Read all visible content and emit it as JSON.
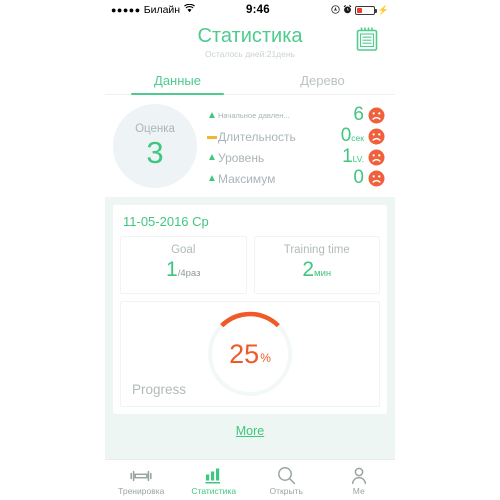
{
  "status_bar": {
    "signal_dots": "●●●●●",
    "carrier": "Билайн",
    "wifi_icon": "wifi-icon",
    "time": "9:46",
    "location_icon": "location-icon",
    "alarm_icon": "alarm-icon",
    "battery_icon": "battery-low-icon",
    "charging_icon": "⚡",
    "battery_level_percent": 22,
    "battery_color": "#ef3b2d"
  },
  "header": {
    "title": "Статистика",
    "subtitle": "Осталось дней:21день",
    "action_icon": "notepad-icon",
    "accent_color": "#4ecb8d"
  },
  "tabs": [
    {
      "label": "Данные",
      "active": true
    },
    {
      "label": "Дерево",
      "active": false
    }
  ],
  "overview": {
    "score_label": "Оценка",
    "score_value": "3",
    "stats": [
      {
        "marker": "up-arrow-icon",
        "marker_color": "#3fc67f",
        "name": "Начальное давлен...",
        "value": "6",
        "unit": "",
        "mood_icon": "sad-face-icon"
      },
      {
        "marker": "dash-icon",
        "marker_color": "#f2b731",
        "name": "Длительность",
        "value": "0",
        "unit": "сек",
        "mood_icon": "sad-face-icon"
      },
      {
        "marker": "up-arrow-icon",
        "marker_color": "#3fc67f",
        "name": "Уровень",
        "value": "1",
        "unit": "LV.",
        "mood_icon": "sad-face-icon"
      },
      {
        "marker": "up-arrow-icon",
        "marker_color": "#3fc67f",
        "name": "Максимум",
        "value": "0",
        "unit": "",
        "mood_icon": "sad-face-icon"
      }
    ]
  },
  "daily": {
    "date": "11-05-2016 Ср",
    "metrics": [
      {
        "label": "Goal",
        "value": "1",
        "unit": "/4раз"
      },
      {
        "label": "Training time",
        "value": "2",
        "unit": "мин"
      }
    ],
    "progress": {
      "label": "Progress",
      "value": "25",
      "symbol": "%",
      "percent": 25,
      "arc_color": "#ef5a28",
      "track_color": "#f2f7f8"
    },
    "more_label": "More"
  },
  "bottom_nav": [
    {
      "label": "Тренировка",
      "icon": "dumbbell-icon",
      "active": false
    },
    {
      "label": "Статистика",
      "icon": "bar-chart-icon",
      "active": true
    },
    {
      "label": "Открыть",
      "icon": "search-icon",
      "active": false
    },
    {
      "label": "Ме",
      "icon": "person-icon",
      "active": false
    }
  ]
}
